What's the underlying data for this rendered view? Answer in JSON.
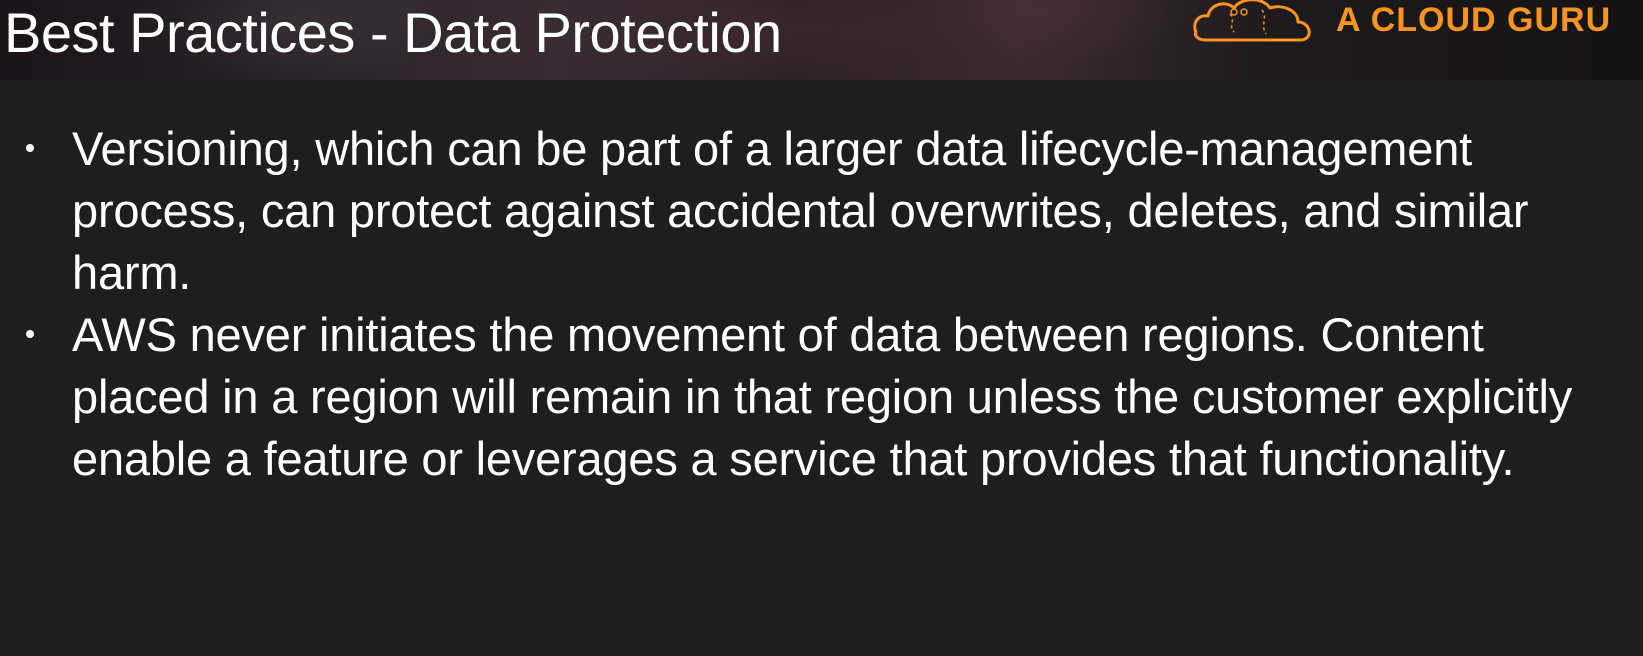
{
  "slide": {
    "title": "Best Practices - Data Protection",
    "brand": {
      "name": "A CLOUD GURU",
      "logo_icon": "cloud-logo-icon",
      "color": "#f7941d"
    },
    "bullets": [
      {
        "text": "Versioning, which can be part of a larger data lifecycle-management process, can protect against accidental overwrites, deletes, and similar harm."
      },
      {
        "text": "AWS never initiates the movement of data between regions. Content placed in a region will remain in that region unless the customer explicitly enable a feature or leverages a service that provides that functionality."
      }
    ],
    "colors": {
      "background": "#1e1e1e",
      "text": "#ffffff",
      "accent": "#f7941d"
    }
  }
}
